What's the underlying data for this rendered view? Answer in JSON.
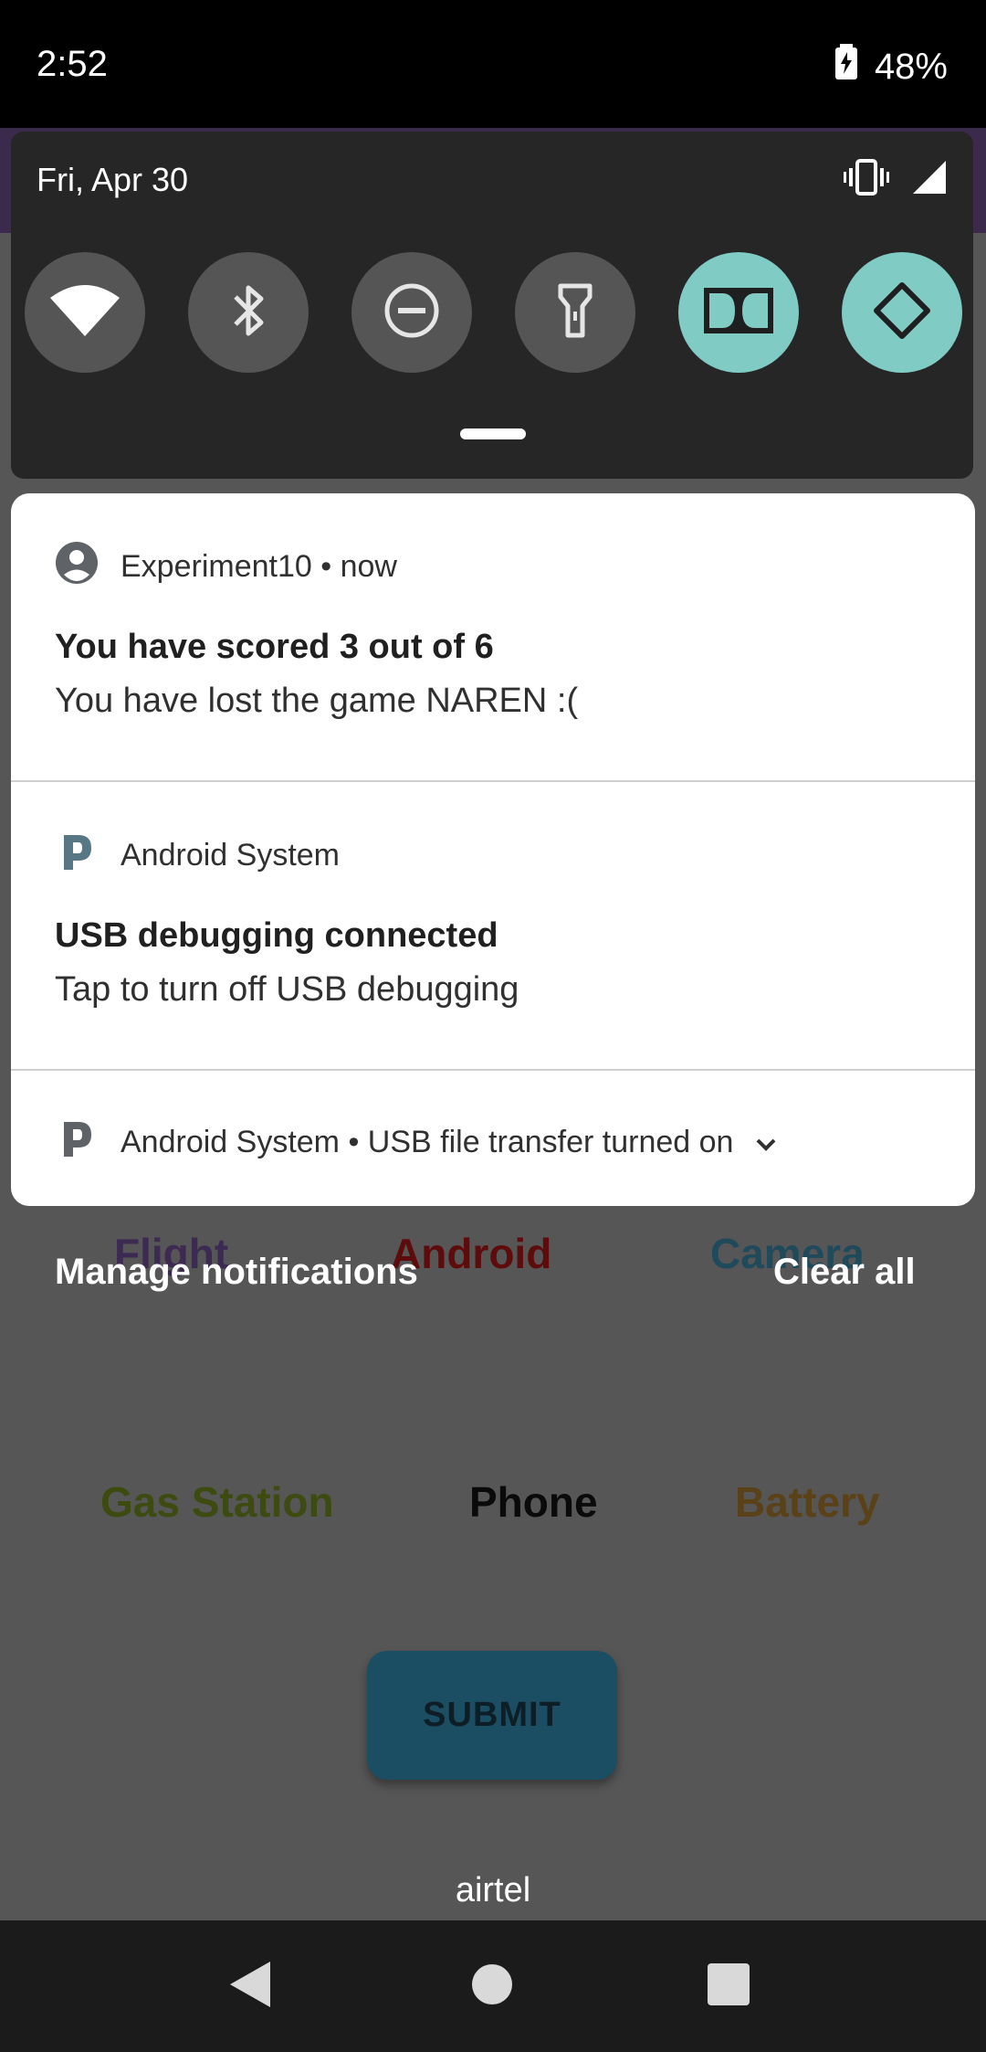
{
  "status_bar": {
    "time": "2:52",
    "battery_percent": "48%"
  },
  "quick_settings": {
    "date": "Fri, Apr 30",
    "tiles": [
      {
        "icon": "wifi-icon",
        "on": false
      },
      {
        "icon": "bluetooth-icon",
        "on": false
      },
      {
        "icon": "do-not-disturb-icon",
        "on": false
      },
      {
        "icon": "flashlight-icon",
        "on": false
      },
      {
        "icon": "dolby-icon",
        "on": true
      },
      {
        "icon": "auto-rotate-icon",
        "on": true
      }
    ],
    "accent_color": "#80cbc4"
  },
  "notifications": [
    {
      "app": "Experiment10",
      "time": "now",
      "title": "You have scored 3 out of 6",
      "text": "You have lost the game NAREN :("
    },
    {
      "app": "Android System",
      "title": "USB debugging connected",
      "text": "Tap to turn off USB debugging"
    },
    {
      "app": "Android System",
      "summary": "USB file transfer turned on"
    }
  ],
  "footer": {
    "manage": "Manage notifications",
    "clear": "Clear all"
  },
  "background_app": {
    "row1": [
      "Flight",
      "Android",
      "Camera"
    ],
    "row2": [
      "Gas Station",
      "Phone",
      "Battery"
    ],
    "submit": "SUBMIT",
    "carrier": "airtel"
  }
}
